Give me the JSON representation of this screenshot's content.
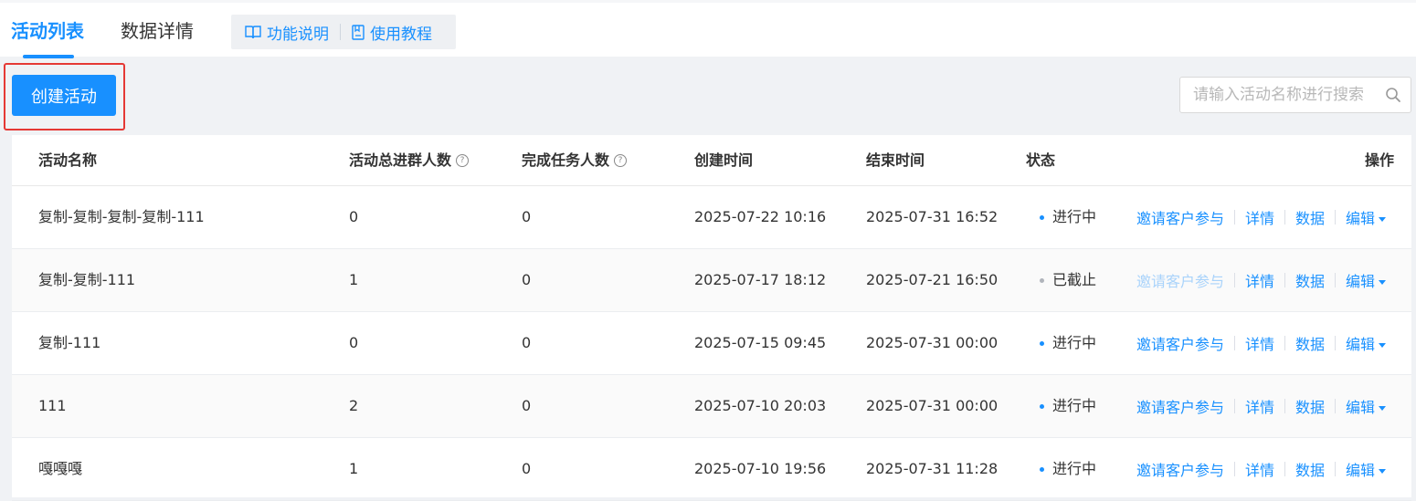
{
  "tabs": [
    {
      "label": "活动列表",
      "active": true
    },
    {
      "label": "数据详情",
      "active": false
    }
  ],
  "help": {
    "func_label": "功能说明",
    "tutorial_label": "使用教程"
  },
  "toolbar": {
    "create_label": "创建活动",
    "search_placeholder": "请输入活动名称进行搜索"
  },
  "table": {
    "columns": [
      "活动名称",
      "活动总进群人数",
      "完成任务人数",
      "创建时间",
      "结束时间",
      "状态",
      "操作"
    ],
    "rows": [
      {
        "name": "复制-复制-复制-复制-111",
        "joined": "0",
        "completed": "0",
        "created": "2025-07-22 10:16",
        "ended": "2025-07-31 16:52",
        "status": "进行中",
        "status_color": "#1890ff",
        "invite_disabled": false
      },
      {
        "name": "复制-复制-111",
        "joined": "1",
        "completed": "0",
        "created": "2025-07-17 18:12",
        "ended": "2025-07-21 16:50",
        "status": "已截止",
        "status_color": "#b0b4bb",
        "invite_disabled": true
      },
      {
        "name": "复制-111",
        "joined": "0",
        "completed": "0",
        "created": "2025-07-15 09:45",
        "ended": "2025-07-31 00:00",
        "status": "进行中",
        "status_color": "#1890ff",
        "invite_disabled": false
      },
      {
        "name": "111",
        "joined": "2",
        "completed": "0",
        "created": "2025-07-10 20:03",
        "ended": "2025-07-31 00:00",
        "status": "进行中",
        "status_color": "#1890ff",
        "invite_disabled": false
      },
      {
        "name": "嘎嘎嘎",
        "joined": "1",
        "completed": "0",
        "created": "2025-07-10 19:56",
        "ended": "2025-07-31 11:28",
        "status": "进行中",
        "status_color": "#1890ff",
        "invite_disabled": false
      }
    ],
    "ops": {
      "invite": "邀请客户参与",
      "detail": "详情",
      "data": "数据",
      "edit": "编辑"
    }
  },
  "colors": {
    "accent": "#1890ff",
    "highlight_border": "#e53935"
  }
}
